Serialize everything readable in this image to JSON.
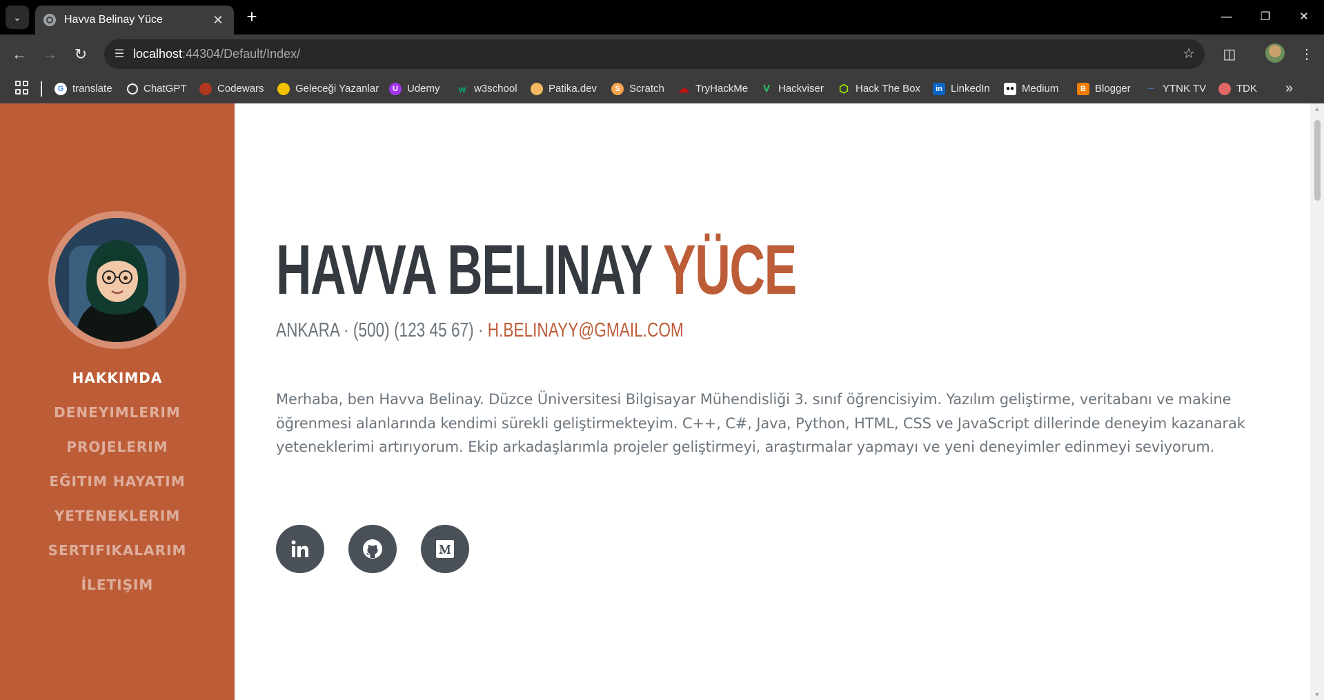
{
  "browser": {
    "tab_title": "Havva Belinay Yüce",
    "url_host": "localhost",
    "url_rest": ":44304/Default/Index/"
  },
  "bookmarks": [
    {
      "label": "translate",
      "icon": "google-icon",
      "color": "#ffffff"
    },
    {
      "label": "ChatGPT",
      "icon": "chatgpt-icon",
      "color": "#ffffff"
    },
    {
      "label": "Codewars",
      "icon": "codewars-icon",
      "color": "#b1361e"
    },
    {
      "label": "Geleceği Yazanlar",
      "icon": "gelecegi-yazanlar-icon",
      "color": "#f2c100"
    },
    {
      "label": "Udemy",
      "icon": "udemy-icon",
      "color": "#a435f0"
    },
    {
      "label": "w3school",
      "icon": "w3school-icon",
      "color": "#04aa6d"
    },
    {
      "label": "Patika.dev",
      "icon": "patika-icon",
      "color": "#f4b860"
    },
    {
      "label": "Scratch",
      "icon": "scratch-icon",
      "color": "#f5a34c"
    },
    {
      "label": "TryHackMe",
      "icon": "tryhackme-icon",
      "color": "#c11111"
    },
    {
      "label": "Hackviser",
      "icon": "hackviser-icon",
      "color": "#22c55e"
    },
    {
      "label": "Hack The Box",
      "icon": "hackthebox-icon",
      "color": "#9fef00"
    },
    {
      "label": "LinkedIn",
      "icon": "linkedin-icon",
      "color": "#0a66c2"
    },
    {
      "label": "Medium",
      "icon": "medium-icon",
      "color": "#000000"
    },
    {
      "label": "Blogger",
      "icon": "blogger-icon",
      "color": "#f57d00"
    },
    {
      "label": "YTNK TV",
      "icon": "ytnk-icon",
      "color": "#4a6fa5"
    },
    {
      "label": "TDK",
      "icon": "tdk-icon",
      "color": "#e06666"
    }
  ],
  "sidebar": {
    "nav": [
      "Hakkımda",
      "Deneyimlerim",
      "Projelerim",
      "Eğitim Hayatım",
      "Yeteneklerim",
      "Sertifikalarım",
      "İletişim"
    ]
  },
  "about": {
    "first_name": "Havva Belinay",
    "last_name": "Yüce",
    "location_phone": "Ankara · (500) (123 45 67) · ",
    "email": "h.belinayy@gmail.com",
    "bio": "Merhaba, ben Havva Belinay. Düzce Üniversitesi Bilgisayar Mühendisliği 3. sınıf öğrencisiyim. Yazılım geliştirme, veritabanı ve makine öğrenmesi alanlarında kendimi sürekli geliştirmekteyim. C++, C#, Java, Python, HTML, CSS ve JavaScript dillerinde deneyim kazanarak yeteneklerimi artırıyorum. Ekip arkadaşlarımla projeler geliştirmeyi, araştırmalar yapmayı ve yeni deneyimler edinmeyi seviyorum."
  },
  "social": [
    {
      "icon": "linkedin-icon"
    },
    {
      "icon": "github-icon"
    },
    {
      "icon": "medium-icon"
    }
  ],
  "colors": {
    "accent": "#bd5d38",
    "heading": "#343a40",
    "text": "#6c757d",
    "social_bg": "#495057"
  }
}
